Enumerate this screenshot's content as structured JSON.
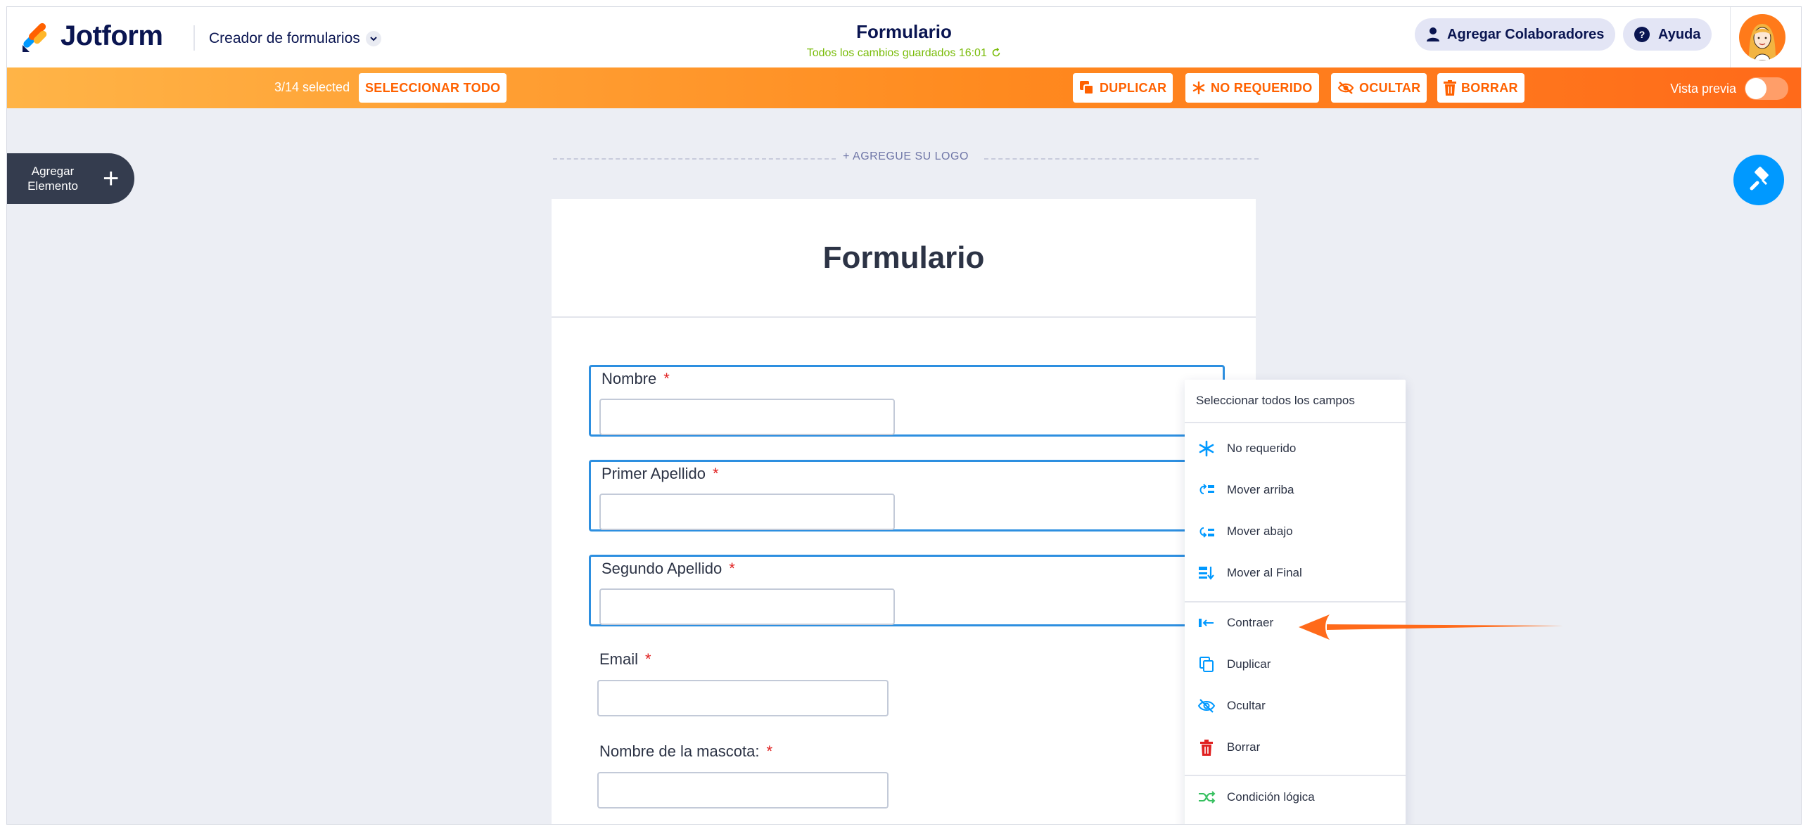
{
  "app": {
    "brand": "Jotform",
    "builder_menu": "Creador de formularios",
    "form_title": "Formulario",
    "save_status": "Todos los cambios guardados 16:01",
    "collaborators_label": "Agregar Colaboradores",
    "help_label": "Ayuda"
  },
  "selection_bar": {
    "count": "3/14 selected",
    "select_all": "SELECCIONAR TODO",
    "duplicate": "DUPLICAR",
    "not_required": "NO REQUERIDO",
    "hide": "OCULTAR",
    "delete": "BORRAR",
    "preview": "Vista previa"
  },
  "canvas": {
    "add_element": "Agregar Elemento",
    "add_logo": "+ AGREGUE SU LOGO"
  },
  "form": {
    "heading": "Formulario",
    "fields": [
      {
        "label": "Nombre",
        "required_mark": "*",
        "selected": true
      },
      {
        "label": "Primer Apellido",
        "required_mark": "*",
        "selected": true
      },
      {
        "label": "Segundo Apellido",
        "required_mark": "*",
        "selected": true
      },
      {
        "label": "Email",
        "required_mark": "*",
        "selected": false
      },
      {
        "label": "Nombre de la mascota:",
        "required_mark": "*",
        "selected": false
      }
    ]
  },
  "context_menu": {
    "header": "Seleccionar todos los campos",
    "items": [
      {
        "label": "No requerido",
        "icon": "asterisk-icon"
      },
      {
        "label": "Mover arriba",
        "icon": "move-up-icon"
      },
      {
        "label": "Mover abajo",
        "icon": "move-down-icon"
      },
      {
        "label": "Mover al Final",
        "icon": "move-to-end-icon"
      },
      {
        "label": "Contraer",
        "icon": "collapse-icon"
      },
      {
        "label": "Duplicar",
        "icon": "duplicate-icon"
      },
      {
        "label": "Ocultar",
        "icon": "hide-icon"
      },
      {
        "label": "Borrar",
        "icon": "trash-icon"
      },
      {
        "label": "Condición lógica",
        "icon": "logic-icon"
      }
    ]
  },
  "colors": {
    "brand_navy": "#0a1551",
    "accent_orange": "#ff6100",
    "selection_blue": "#2d8fe0",
    "menu_icon_blue": "#0099ff",
    "delete_red": "#e02020",
    "logic_green": "#37c060",
    "saved_green": "#78bb07"
  }
}
